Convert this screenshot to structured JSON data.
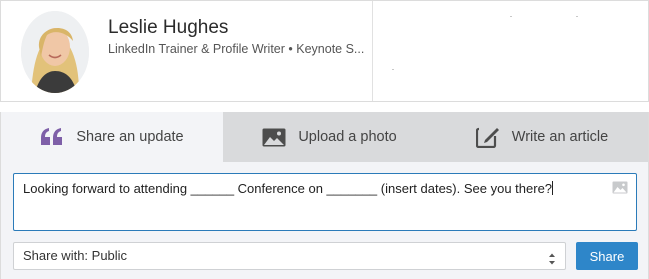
{
  "profile": {
    "name": "Leslie Hughes",
    "headline": "LinkedIn Trainer & Profile Writer • Keynote S..."
  },
  "tabs": [
    {
      "label": "Share an update",
      "icon": "quote-icon",
      "active": true
    },
    {
      "label": "Upload a photo",
      "icon": "photo-icon",
      "active": false
    },
    {
      "label": "Write an article",
      "icon": "edit-article-icon",
      "active": false
    }
  ],
  "composer": {
    "text": "Looking forward to attending ______ Conference on _______ (insert dates). See you there?"
  },
  "share": {
    "visibility": "Share with: Public",
    "button": "Share"
  },
  "colors": {
    "accent_blue": "#2e86c9",
    "quote_purple": "#7e5fa8",
    "inactive_tab": "#d9dadc",
    "composer_bg": "#f3f4f7"
  }
}
